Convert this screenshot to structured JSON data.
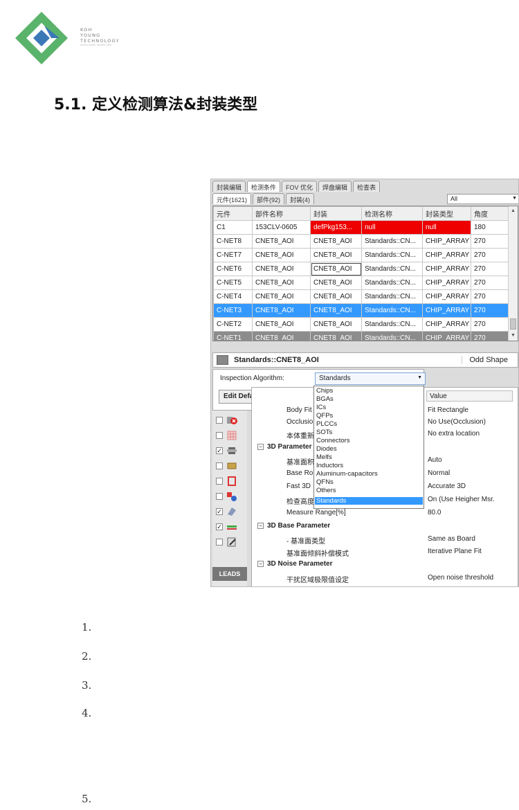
{
  "logo": {
    "line1": "KOH",
    "line2": "YOUNG",
    "line3": "TECHNOLOGY",
    "tagline": "INTELLIGENT INSPECTION"
  },
  "heading": "5.1. 定义检测算法&封装类型",
  "app": {
    "top_tabs": [
      "封装编辑",
      "检测条件",
      "FOV 优化",
      "焊盘编辑",
      "检查表"
    ],
    "sub_tabs": [
      "元件(1621)",
      "部件(92)",
      "封装(4)"
    ],
    "filter": {
      "value": "All"
    },
    "columns": [
      "元件",
      "部件名称",
      "封装",
      "检测名称",
      "封装类型",
      "角度"
    ],
    "rows": [
      [
        "C1",
        "153CLV-0605",
        "defPkg153...",
        "null",
        "null",
        "180"
      ],
      [
        "C-NET8",
        "CNET8_AOI",
        "CNET8_AOI",
        "Standards::CN...",
        "CHIP_ARRAY",
        "270"
      ],
      [
        "C-NET7",
        "CNET8_AOI",
        "CNET8_AOI",
        "Standards::CN...",
        "CHIP_ARRAY",
        "270"
      ],
      [
        "C-NET6",
        "CNET8_AOI",
        "CNET8_AOI",
        "Standards::CN...",
        "CHIP_ARRAY",
        "270"
      ],
      [
        "C-NET5",
        "CNET8_AOI",
        "CNET8_AOI",
        "Standards::CN...",
        "CHIP_ARRAY",
        "270"
      ],
      [
        "C-NET4",
        "CNET8_AOI",
        "CNET8_AOI",
        "Standards::CN...",
        "CHIP_ARRAY",
        "270"
      ],
      [
        "C-NET3",
        "CNET8_AOI",
        "CNET8_AOI",
        "Standards::CN...",
        "CHIP_ARRAY",
        "270"
      ],
      [
        "C-NET2",
        "CNET8_AOI",
        "CNET8_AOI",
        "Standards::CN...",
        "CHIP_ARRAY",
        "270"
      ],
      [
        "C-NET1",
        "CNET8_AOI",
        "CNET8_AOI",
        "Standards::CN...",
        "CHIP_ARRAY",
        "270"
      ]
    ],
    "panel_title": "Standards::CNET8_AOI",
    "odd_shape": "Odd Shape",
    "algo_label": "Inspection Algorithm:",
    "algo_value": "Standards",
    "edit_btn": "Edit Default Condition",
    "value_header": "Value",
    "leads": "LEADS",
    "dropdown": [
      "Chips",
      "BGAs",
      "ICs",
      "QFPs",
      "PLCCs",
      "SOTs",
      "Connectors",
      "Diodes",
      "Melfs",
      "Inductors",
      "Aluminum-capacitors",
      "QFNs",
      "Others",
      "Standards"
    ],
    "props": [
      {
        "name": "Body Fit",
        "value": "Fit Rectangle",
        "sec": false
      },
      {
        "name": "Occlusion",
        "value": "No Use(Occlusion)",
        "sec": false
      },
      {
        "name": "本体重新",
        "value": "No extra location",
        "sec": false
      },
      {
        "name": "3D Parameter",
        "value": "",
        "sec": true
      },
      {
        "name": "基准面积",
        "value": "Auto",
        "sec": false
      },
      {
        "name": "Base Ro",
        "value": "Normal",
        "sec": false
      },
      {
        "name": "Fast 3D",
        "value": "Accurate 3D",
        "sec": false
      },
      {
        "name": "检查高度",
        "value": "On (Use Heigher Msr.",
        "sec": false
      },
      {
        "name": "Measure Range[%]",
        "value": "80.0",
        "sec": false
      },
      {
        "name": "3D Base Parameter",
        "value": "",
        "sec": true
      },
      {
        "name": "-    基准面类型",
        "value": "Same as Board",
        "sec": false
      },
      {
        "name": "基准面倾斜补偿模式",
        "value": "Iterative Plane Fit",
        "sec": false
      },
      {
        "name": "3D Noise Parameter",
        "value": "",
        "sec": true
      },
      {
        "name": "干扰区域极限值设定",
        "value": "Open noise threshold",
        "sec": false
      }
    ]
  },
  "list_numbers": [
    "1.",
    "2.",
    "3.",
    "4.",
    "5."
  ]
}
